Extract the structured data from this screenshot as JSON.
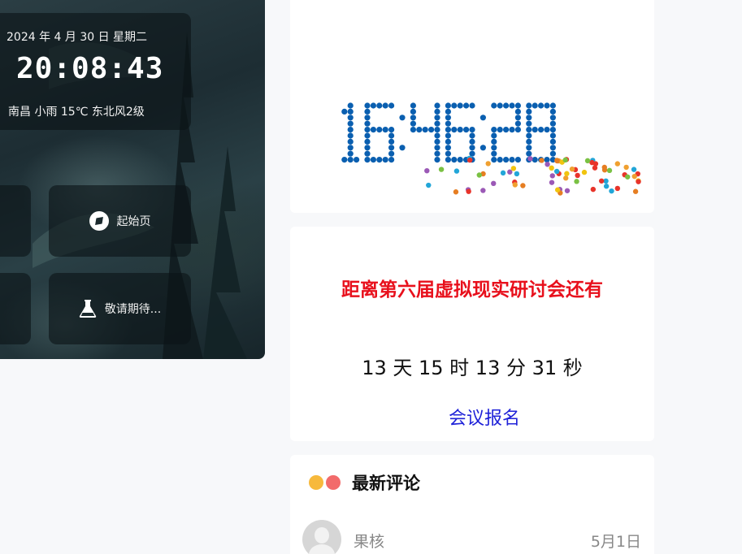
{
  "widget": {
    "date": "2024 年 4 月 30 日 星期二",
    "time": "20:08:43",
    "weather": "南昌 小雨 15℃ 东北风2级"
  },
  "nav": {
    "start_label": "起始页",
    "soon_label": "敬请期待..."
  },
  "clock": {
    "time": "16:46:28",
    "dot_color": "#0a5fb0"
  },
  "countdown": {
    "title": "距离第六届虚拟现实研讨会还有",
    "remaining": "13 天 15 时 13 分 31 秒",
    "link": "会议报名"
  },
  "comments": {
    "title": "最新评论",
    "dot_colors": [
      "#f7b93c",
      "#f26b6b"
    ],
    "items": [
      {
        "user": "果核",
        "date": "5月1日"
      }
    ]
  }
}
